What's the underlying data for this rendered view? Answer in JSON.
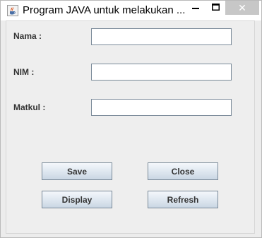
{
  "window": {
    "title": "Program JAVA untuk melakukan ...",
    "app_icon": "java-coffee-cup-icon",
    "controls": {
      "minimize_icon": "minimize-icon",
      "maximize_icon": "maximize-icon",
      "close_icon": "close-icon",
      "close_glyph": "✕",
      "close_color": "#c7c7c7"
    }
  },
  "form": {
    "fields": [
      {
        "label": "Nama  :",
        "value": ""
      },
      {
        "label": "NIM :",
        "value": ""
      },
      {
        "label": "Matkul :",
        "value": ""
      }
    ]
  },
  "buttons": {
    "save": "Save",
    "close": "Close",
    "display": "Display",
    "refresh": "Refresh"
  },
  "colors": {
    "panel_background": "#eeeeee",
    "button_border": "#7a8a99",
    "button_gradient_top": "#f4f7fb",
    "button_gradient_bottom": "#c9d6e3"
  }
}
